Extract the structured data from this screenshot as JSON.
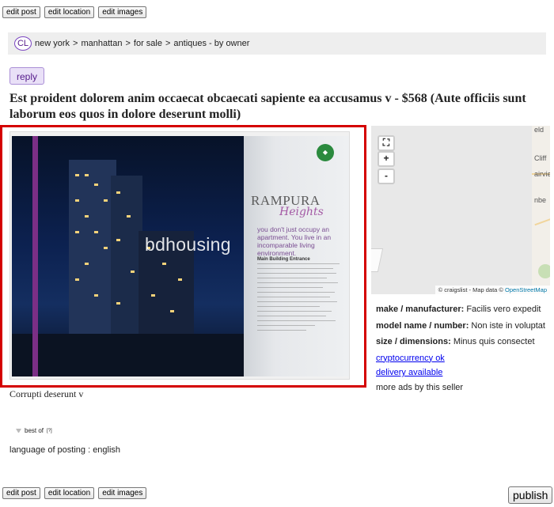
{
  "toolbar_top": {
    "edit_post": "edit post",
    "edit_location": "edit location",
    "edit_images": "edit images"
  },
  "toolbar_bottom": {
    "edit_post": "edit post",
    "edit_location": "edit location",
    "edit_images": "edit images",
    "publish": "publish"
  },
  "breadcrumb": {
    "logo": "CL",
    "items": [
      "new york",
      "manhattan",
      "for sale",
      "antiques - by owner"
    ],
    "separator": ">"
  },
  "reply_label": "reply",
  "title": "Est proident dolorem anim occaecat obcaecati sapiente ea accusamus v - $568 (Aute officiis sunt laborum eos quos in dolore deserunt molli)",
  "image": {
    "watermark": "bdhousing",
    "brochure_heading": "RAMPURA",
    "brochure_script": "Heights",
    "brochure_tagline": "you don't just occupy an apartment. You live in an incomparable living environment.",
    "brochure_list_title": "Main Building Entrance"
  },
  "caption": "Corrupti deserunt v",
  "best_of": {
    "label": "best of",
    "sup": "[?]"
  },
  "language": "language of posting : english",
  "map": {
    "zoom_in": "+",
    "zoom_out": "-",
    "fullscreen": "⛶",
    "labels": [
      "eld",
      "Cliff",
      "airvie",
      "nbe"
    ],
    "attribution_prefix": "© craigslist - Map data ©",
    "attribution_link": "OpenStreetMap"
  },
  "attributes": [
    {
      "key": "make / manufacturer:",
      "value": "Facilis vero expedit"
    },
    {
      "key": "model name / number:",
      "value": "Non iste in voluptat"
    },
    {
      "key": "size / dimensions:",
      "value": "Minus quis consectet"
    }
  ],
  "links": {
    "crypto": "cryptocurrency ok",
    "delivery": "delivery available",
    "more_ads": "more ads by this seller"
  },
  "colors": {
    "gallery_border": "#d40000",
    "reply_bg": "#e9e0f7",
    "link": "#0000ee",
    "breadcrumb_bg": "#eeeeee"
  }
}
